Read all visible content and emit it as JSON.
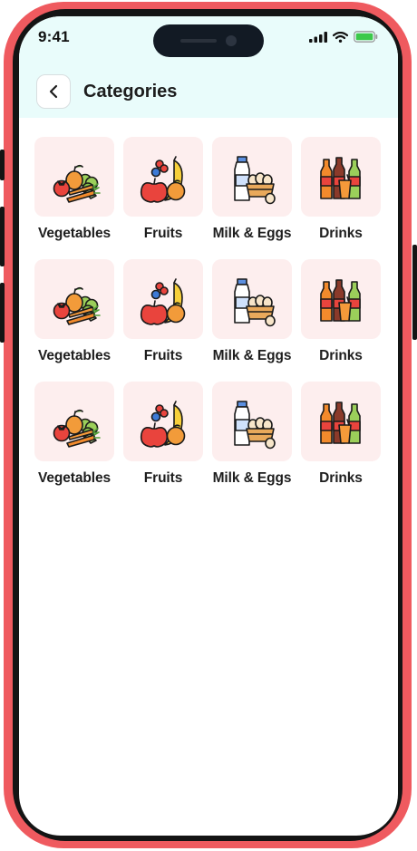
{
  "status_bar": {
    "time": "9:41",
    "icons": [
      "signal-icon",
      "wifi-icon",
      "battery-icon"
    ]
  },
  "header": {
    "title": "Categories",
    "back_icon": "chevron-left-icon"
  },
  "colors": {
    "frame": "#ef5a5f",
    "header_bg": "#e9fcfb",
    "tile_bg": "#fdeeee"
  },
  "categories": [
    {
      "label": "Vegetables",
      "icon": "vegetables-icon"
    },
    {
      "label": "Fruits",
      "icon": "fruits-icon"
    },
    {
      "label": "Milk & Eggs",
      "icon": "milk-eggs-icon"
    },
    {
      "label": "Drinks",
      "icon": "drinks-icon"
    },
    {
      "label": "Vegetables",
      "icon": "vegetables-icon"
    },
    {
      "label": "Fruits",
      "icon": "fruits-icon"
    },
    {
      "label": "Milk & Eggs",
      "icon": "milk-eggs-icon"
    },
    {
      "label": "Drinks",
      "icon": "drinks-icon"
    },
    {
      "label": "Vegetables",
      "icon": "vegetables-icon"
    },
    {
      "label": "Fruits",
      "icon": "fruits-icon"
    },
    {
      "label": "Milk & Eggs",
      "icon": "milk-eggs-icon"
    },
    {
      "label": "Drinks",
      "icon": "drinks-icon"
    }
  ]
}
